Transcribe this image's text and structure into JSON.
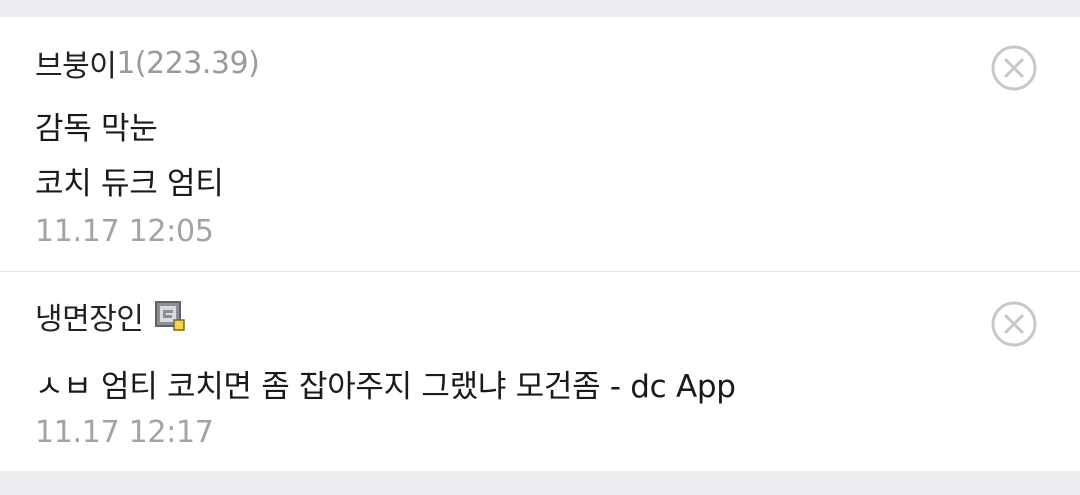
{
  "comments": [
    {
      "nickname": "브붕이",
      "ip": "1(223.39)",
      "lines": [
        "감독 막눈",
        "코치 듀크 엄티"
      ],
      "time": "11.17 12:05",
      "delete_icon": "close-circle-icon"
    },
    {
      "nickname": "냉면장인",
      "badge_icon": "gallery-member-icon",
      "lines": [
        "ㅅㅂ 엄티 코치면 좀 잡아주지 그랬냐 모건좀 - dc App"
      ],
      "time": "11.17 12:17",
      "delete_icon": "close-circle-icon"
    }
  ],
  "colors": {
    "background": "#eceef2",
    "card": "#ffffff",
    "text": "#1a1a1a",
    "muted": "#a3a3a3",
    "icon": "#c8c8c8"
  }
}
